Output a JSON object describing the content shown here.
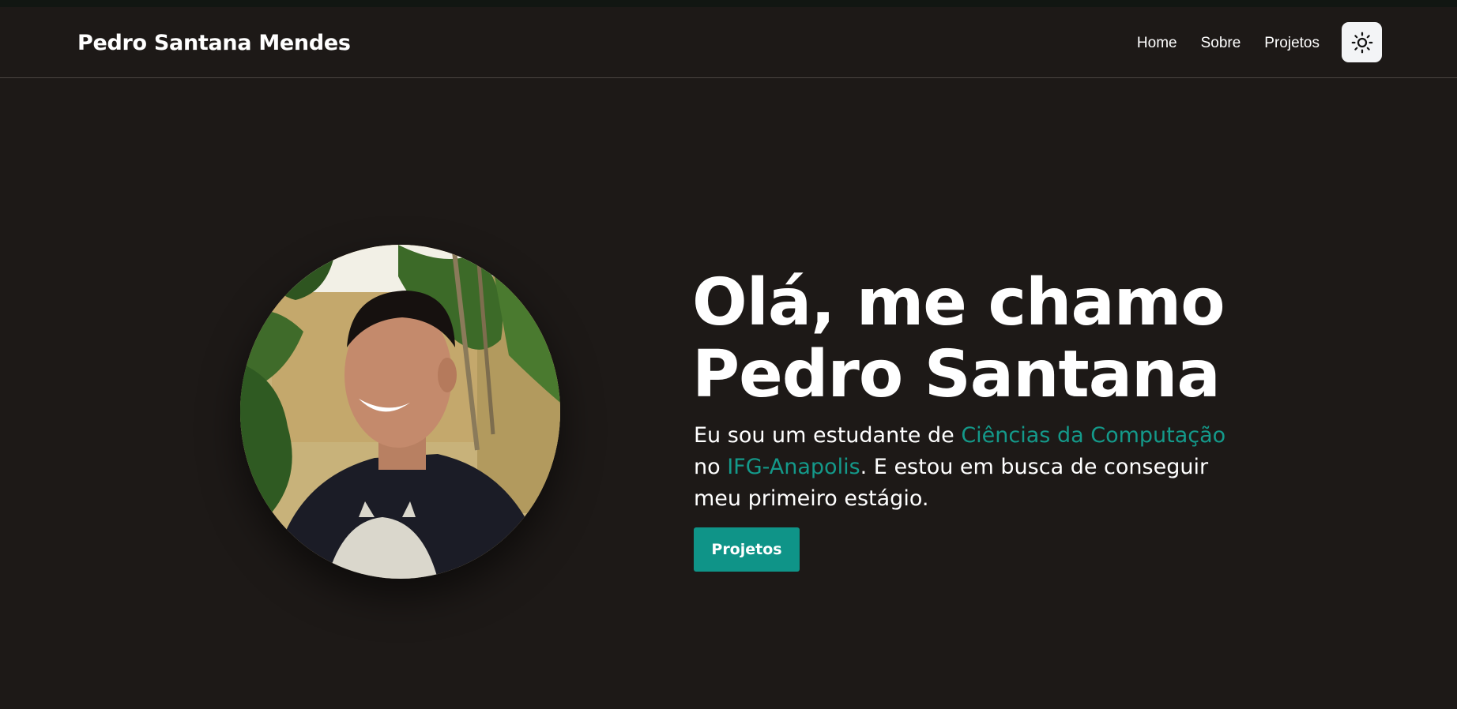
{
  "site": {
    "brand": "Pedro Santana Mendes"
  },
  "nav": {
    "items": [
      {
        "label": "Home"
      },
      {
        "label": "Sobre"
      },
      {
        "label": "Projetos"
      }
    ]
  },
  "theme_toggle": {
    "icon": "sun-icon"
  },
  "hero": {
    "headline_line1": "Olá, me chamo",
    "headline_line2": "Pedro Santana",
    "intro": {
      "part1": "Eu sou um estudante de ",
      "highlight1": "Ciências da Computação",
      "part2": "no ",
      "highlight2": "IFG-Anapolis",
      "part3": ". E estou em busca de conseguir meu primeiro estágio."
    },
    "cta_label": "Projetos",
    "photo": {
      "description_icon": "profile-photo"
    }
  },
  "colors": {
    "background": "#1d1917",
    "accent": "#0f9488",
    "highlight_text": "#14998a",
    "toggle_bg": "#f3f4f6"
  }
}
